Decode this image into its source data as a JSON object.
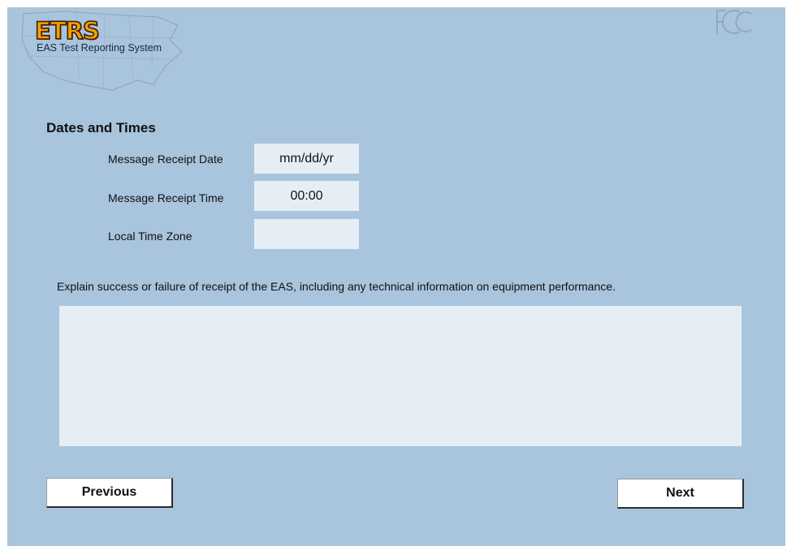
{
  "header": {
    "logo_text": "ETRS",
    "logo_subtitle": "EAS Test Reporting System",
    "agency_mark": "FCC"
  },
  "section": {
    "title": "Dates and Times"
  },
  "fields": [
    {
      "label": "Message Receipt Date",
      "value": "mm/dd/yr"
    },
    {
      "label": "Message Receipt Time",
      "value": "00:00"
    },
    {
      "label": "Local Time Zone",
      "value": ""
    }
  ],
  "explanation": {
    "prompt": "Explain success or failure of receipt of the EAS, including any  technical information on equipment performance.",
    "value": ""
  },
  "buttons": {
    "previous": "Previous",
    "next": "Next"
  },
  "colors": {
    "background": "#a9c4dd",
    "field_background": "#e6eef5",
    "logo_fill": "#f5a000"
  }
}
